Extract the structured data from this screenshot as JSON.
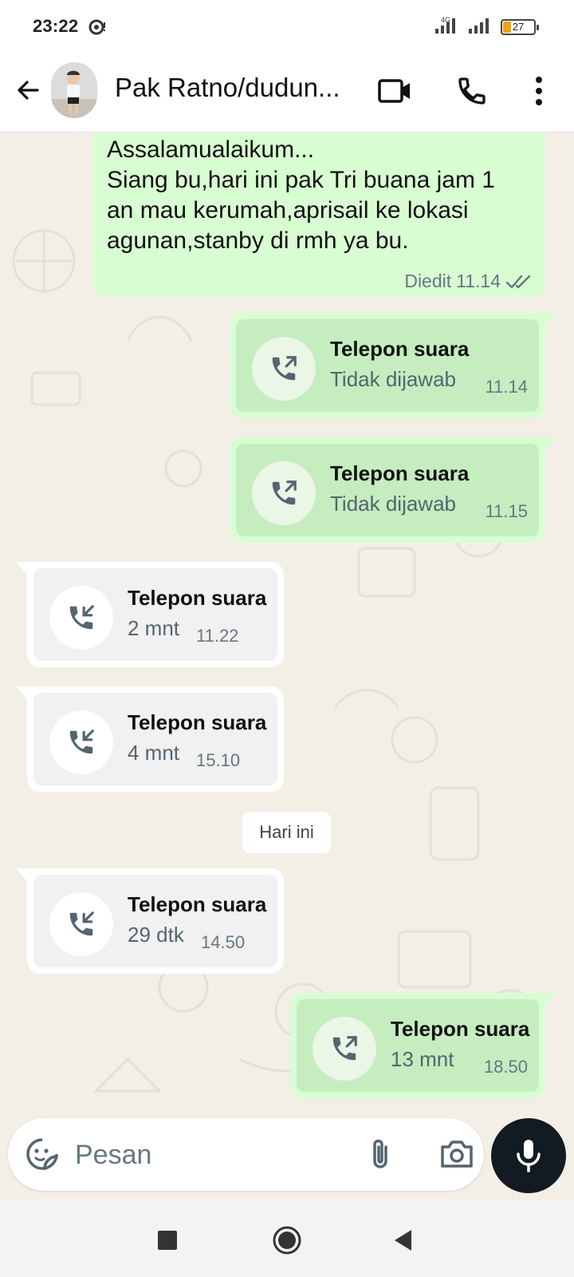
{
  "status_bar": {
    "time": "23:22",
    "network": "4G",
    "battery": "27",
    "battery_color": "#f2a21b"
  },
  "header": {
    "contact_name": "Pak Ratno/dudun...",
    "icons": [
      "back-arrow-icon",
      "video-call-icon",
      "voice-call-icon",
      "more-options-icon"
    ]
  },
  "messages": [
    {
      "type": "text",
      "direction": "out",
      "lines": [
        "Assalamualaikum...",
        "Siang bu,hari ini pak Tri buana jam 1",
        "an mau kerumah,aprisail ke lokasi",
        "agunan,stanby di rmh ya bu."
      ],
      "edited": "Diedit",
      "time": "11.14",
      "status": "read-double-check"
    },
    {
      "type": "call",
      "direction": "out",
      "title": "Telepon suara",
      "sub": "Tidak dijawab",
      "time": "11.14"
    },
    {
      "type": "call",
      "direction": "out",
      "title": "Telepon suara",
      "sub": "Tidak dijawab",
      "time": "11.15"
    },
    {
      "type": "call",
      "direction": "in",
      "title": "Telepon suara",
      "sub": "2 mnt",
      "time": "11.22"
    },
    {
      "type": "call",
      "direction": "in",
      "title": "Telepon suara",
      "sub": "4 mnt",
      "time": "15.10"
    },
    {
      "type": "date",
      "label": "Hari ini"
    },
    {
      "type": "call",
      "direction": "in",
      "title": "Telepon suara",
      "sub": "29 dtk",
      "time": "14.50"
    },
    {
      "type": "call",
      "direction": "out",
      "title": "Telepon suara",
      "sub": "13 mnt",
      "time": "18.50"
    }
  ],
  "input": {
    "placeholder": "Pesan"
  },
  "colors": {
    "outgoing_bubble": "#d9fdd3",
    "incoming_bubble": "#ffffff",
    "chat_background": "#f3efe7",
    "mic_button": "#111b21"
  }
}
